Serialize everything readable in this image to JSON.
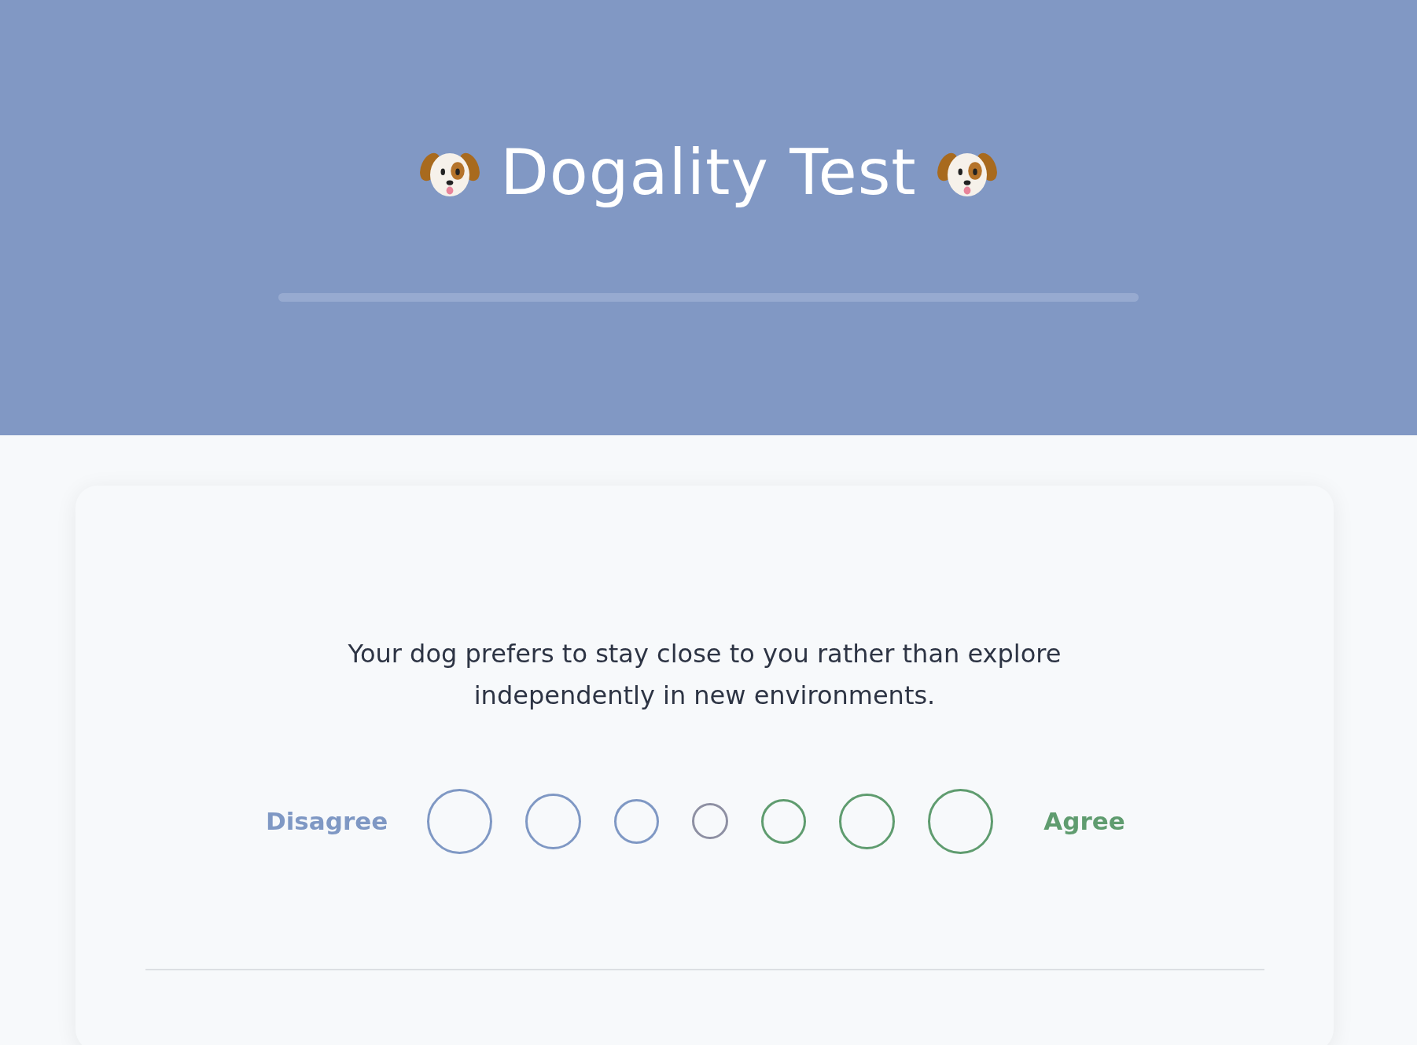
{
  "header": {
    "title": "Dogality Test",
    "progress": {
      "level": 0
    }
  },
  "question": {
    "text": "Your dog prefers to stay close to you rather than explore independently in new environments.",
    "scale": {
      "left_label": "Disagree",
      "right_label": "Agree",
      "options": [
        {
          "selected": false,
          "color": "#7f98c4"
        },
        {
          "selected": false,
          "color": "#7f98c4"
        },
        {
          "selected": false,
          "color": "#7f98c4"
        },
        {
          "selected": false,
          "color": "#8e90a3"
        },
        {
          "selected": false,
          "color": "#5f9c6f"
        },
        {
          "selected": false,
          "color": "#5f9c6f"
        },
        {
          "selected": false,
          "color": "#5f9c6f"
        }
      ]
    }
  }
}
